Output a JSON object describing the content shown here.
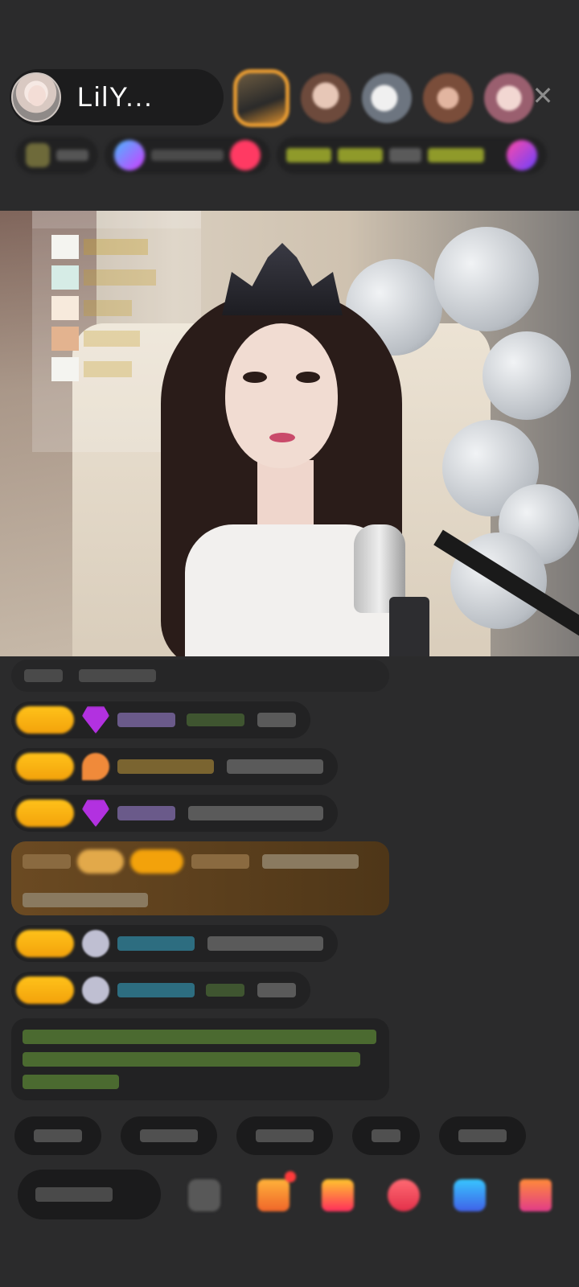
{
  "header": {
    "host_name": "LilY...",
    "close_symbol": "✕",
    "viewers": [
      "top-viewer-1",
      "viewer-2",
      "viewer-3",
      "viewer-4",
      "viewer-5"
    ]
  },
  "colors": {
    "background": "#2b2b2c",
    "level_badge": "#f3a20b",
    "host_name": "#ffffff",
    "notice_text": "#8fc85a"
  },
  "icons": {
    "close": "close-icon",
    "gift": "gift-icon",
    "more": "more-icon"
  }
}
